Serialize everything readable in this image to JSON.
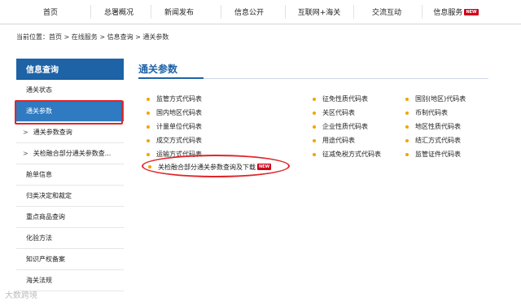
{
  "nav": {
    "items": [
      {
        "label": "首页"
      },
      {
        "label": "总署概况"
      },
      {
        "label": "新闻发布"
      },
      {
        "label": "信息公开"
      },
      {
        "label": "互联网+海关"
      },
      {
        "label": "交流互动"
      },
      {
        "label": "信息服务",
        "badge": "NEW"
      }
    ]
  },
  "breadcrumb": "当前位置：首页 > 在线服务 > 信息查询 > 通关参数",
  "sidebar": {
    "header": "信息查询",
    "items": [
      {
        "label": "通关状态"
      },
      {
        "label": "通关参数",
        "active": true
      },
      {
        "label": "通关参数查询",
        "sub": true
      },
      {
        "label": "关检融合部分通关参数查...",
        "sub": true
      },
      {
        "label": "舱单信息"
      },
      {
        "label": "归类决定和裁定"
      },
      {
        "label": "重点商品查询"
      },
      {
        "label": "化验方法"
      },
      {
        "label": "知识产权备案"
      },
      {
        "label": "海关法规"
      }
    ]
  },
  "main": {
    "title": "通关参数",
    "columns": [
      [
        "监管方式代码表",
        "国内地区代码表",
        "计量单位代码表",
        "成交方式代码表",
        "运输方式代码表"
      ],
      [
        "征免性质代码表",
        "关区代码表",
        "企业性质代码表",
        "用途代码表",
        "征减免税方式代码表"
      ],
      [
        "国别(地区)代码表",
        "币制代码表",
        "地区性质代码表",
        "结汇方式代码表",
        "监管证件代码表"
      ]
    ],
    "special_link": {
      "label": "关检融合部分通关参数查询及下载",
      "badge": "NEW"
    }
  },
  "watermark": "大数跨境",
  "colors": {
    "brand_blue": "#1e63a6",
    "active_blue": "#2f7ac1",
    "highlight_red": "#e0262a",
    "bullet": "#f0a500"
  }
}
